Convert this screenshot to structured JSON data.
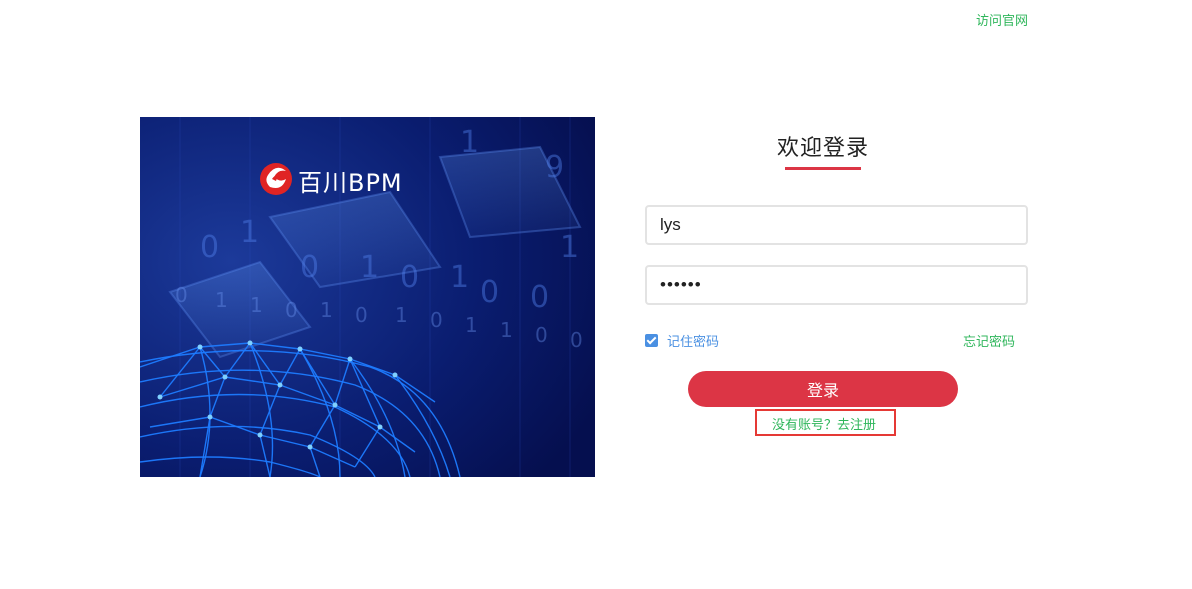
{
  "header": {
    "visit_site_label": "访问官网"
  },
  "hero": {
    "brand_name": "百川BPM"
  },
  "login": {
    "title": "欢迎登录",
    "username_value": "lys",
    "password_value": "••••••",
    "remember_label": "记住密码",
    "remember_checked": true,
    "forgot_label": "忘记密码",
    "submit_label": "登录",
    "register_label": "没有账号？去注册"
  },
  "colors": {
    "accent_red": "#dc3545",
    "link_green": "#2fb65b",
    "check_blue": "#4a90e2",
    "hero_bg": "#071563"
  }
}
